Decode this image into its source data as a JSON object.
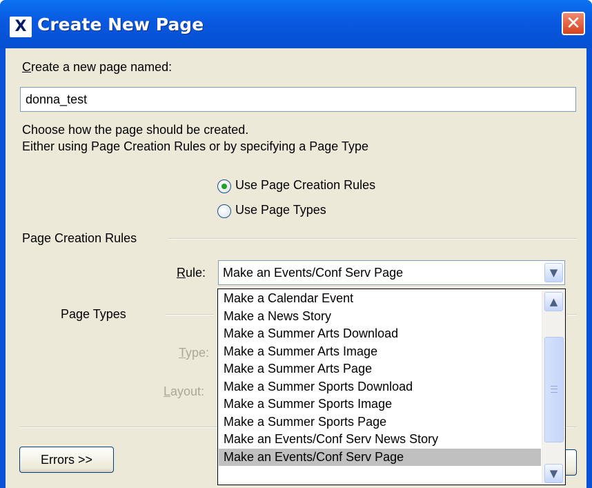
{
  "window": {
    "title": "Create New Page",
    "app_icon": "X",
    "close_icon": "✕"
  },
  "form": {
    "name_label": "Create a new page named:",
    "name_value": "donna_test",
    "instructions_line1": "Choose how the page should be created.",
    "instructions_line2": "Either using Page Creation Rules or by specifying a Page Type",
    "radio_rules_label": "Use Page Creation Rules",
    "radio_types_label": "Use Page Types",
    "selected_option": "Use Page Creation Rules"
  },
  "rules_group": {
    "title": "Page Creation Rules",
    "rule_label": "Rule:",
    "rule_selected": "Make an Events/Conf Serv Page"
  },
  "types_group": {
    "title": "Page Types",
    "type_label": "Type:",
    "layout_label": "Layout:"
  },
  "dropdown": {
    "items": [
      "Make a Calendar Event",
      "Make a News Story",
      "Make a Summer Arts Download",
      "Make a Summer Arts Image",
      "Make a Summer Arts Page",
      "Make a Summer Sports Download",
      "Make a Summer Sports Image",
      "Make a Summer Sports Page",
      "Make an Events/Conf Serv News Story",
      "Make an Events/Conf Serv Page"
    ],
    "selected_index": 9,
    "scroll_up_icon": "chevron-up-icon",
    "scroll_down_icon": "chevron-down-icon"
  },
  "buttons": {
    "errors": "Errors >>"
  },
  "colors": {
    "titlebar": "#0a58e0",
    "dialog_bg": "#ece9d8",
    "selection": "#c0c0c0",
    "radio_dot": "#21a121"
  }
}
